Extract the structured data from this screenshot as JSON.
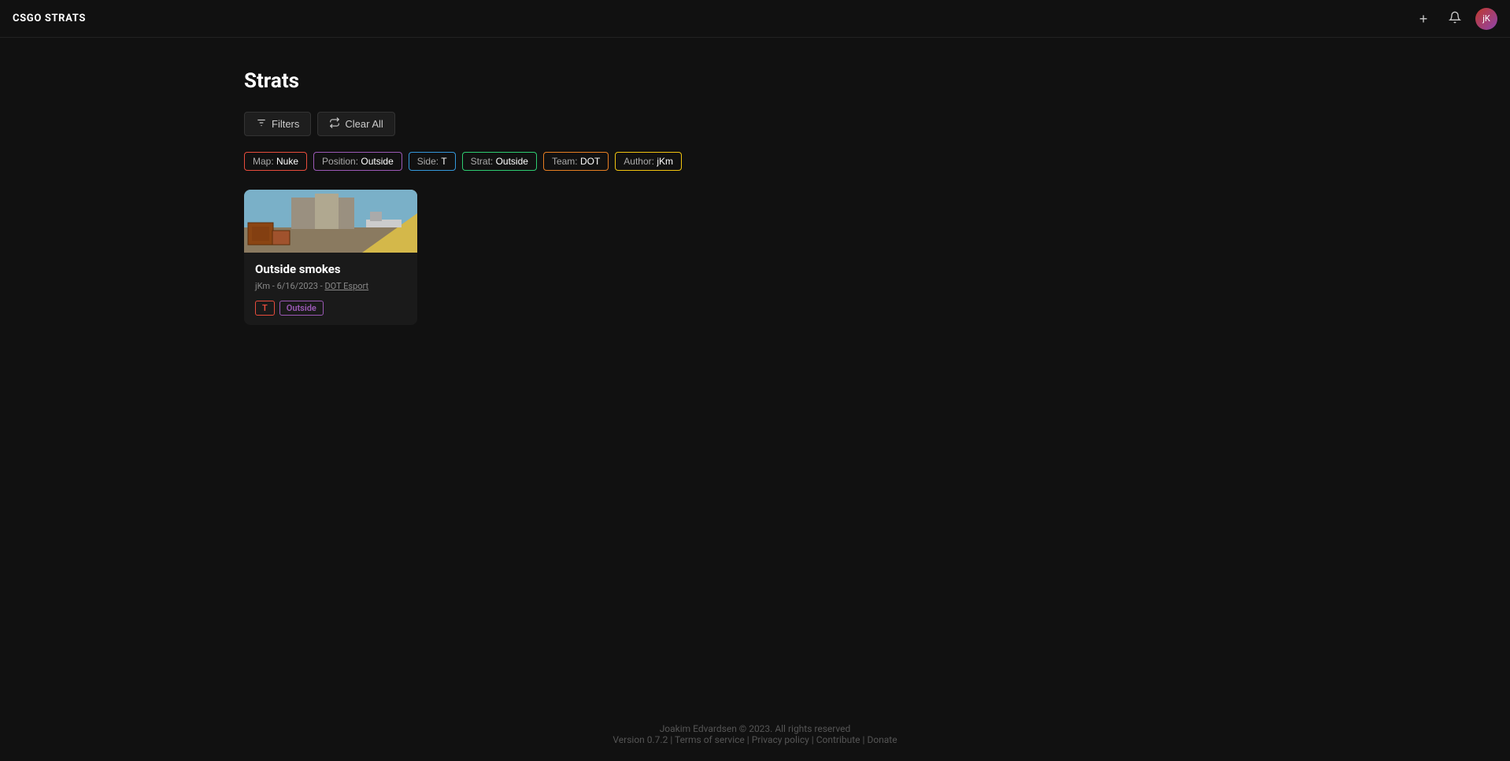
{
  "app": {
    "brand": "CSGO STRATS"
  },
  "header": {
    "add_icon": "plus-icon",
    "notification_icon": "bell-icon",
    "avatar_text": "jK"
  },
  "page": {
    "title": "Strats"
  },
  "toolbar": {
    "filters_label": "Filters",
    "clear_all_label": "Clear All"
  },
  "filter_tags": [
    {
      "id": "map",
      "type": "map",
      "prefix": "Map: ",
      "value": "Nuke"
    },
    {
      "id": "position",
      "type": "position",
      "prefix": "Position: ",
      "value": "Outside"
    },
    {
      "id": "side",
      "type": "side",
      "prefix": "Side: ",
      "value": "T"
    },
    {
      "id": "strat",
      "type": "strat",
      "prefix": "Strat: ",
      "value": "Outside"
    },
    {
      "id": "team",
      "type": "team",
      "prefix": "Team: ",
      "value": "DOT"
    },
    {
      "id": "author",
      "type": "author",
      "prefix": "Author: ",
      "value": "jKm"
    }
  ],
  "strats": [
    {
      "id": "outside-smokes",
      "title": "Outside smokes",
      "author": "jKm",
      "date": "6/16/2023",
      "team": "DOT Esport",
      "side_tag": "T",
      "position_tag": "Outside"
    }
  ],
  "footer": {
    "copyright": "Joakim Edvardsen © 2023. All rights reserved",
    "version": "Version 0.7.2",
    "terms_label": "Terms of service",
    "privacy_label": "Privacy policy",
    "contribute_label": "Contribute",
    "donate_label": "Donate"
  }
}
